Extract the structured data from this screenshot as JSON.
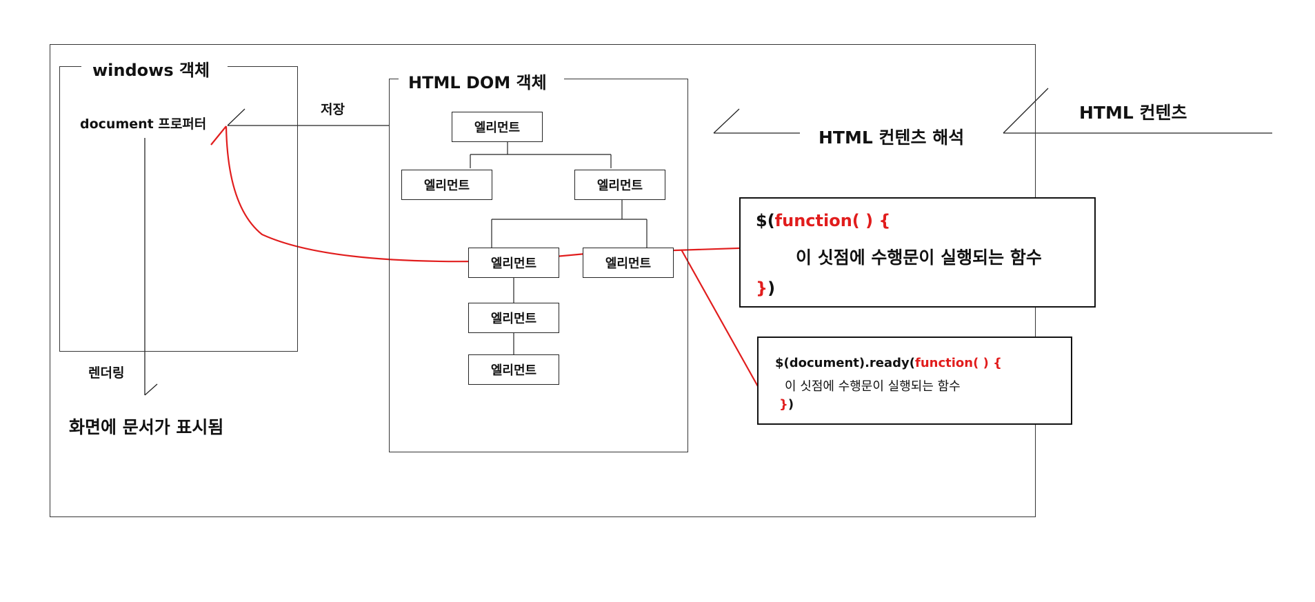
{
  "windows_section": {
    "title": "windows 객체",
    "document_property": "document 프로퍼터",
    "rendering": "렌더링",
    "display_result": "화면에 문서가 표시됨"
  },
  "store_label": "저장",
  "dom_section": {
    "title": "HTML DOM 객체",
    "elements": [
      "엘리먼트",
      "엘리먼트",
      "엘리먼트",
      "엘리먼트",
      "엘리먼트",
      "엘리먼트",
      "엘리먼트"
    ]
  },
  "parse_label": "HTML 컨텐츠 해석",
  "content_label": "HTML 컨텐츠",
  "code_box_1": {
    "line1_prefix": "$(",
    "line1_red": "function( ) {",
    "line2": "이 싯점에 수행문이 실행되는 함수",
    "line3_red": "}",
    "line3_suffix": ")"
  },
  "code_box_2": {
    "line1_prefix": "$(document).ready(",
    "line1_red": "function( ) {",
    "line2": "이 싯점에 수행문이 실행되는 함수",
    "line3_red": "}",
    "line3_suffix": ")"
  },
  "colors": {
    "accent": "#e11d1d",
    "line": "#222222"
  }
}
